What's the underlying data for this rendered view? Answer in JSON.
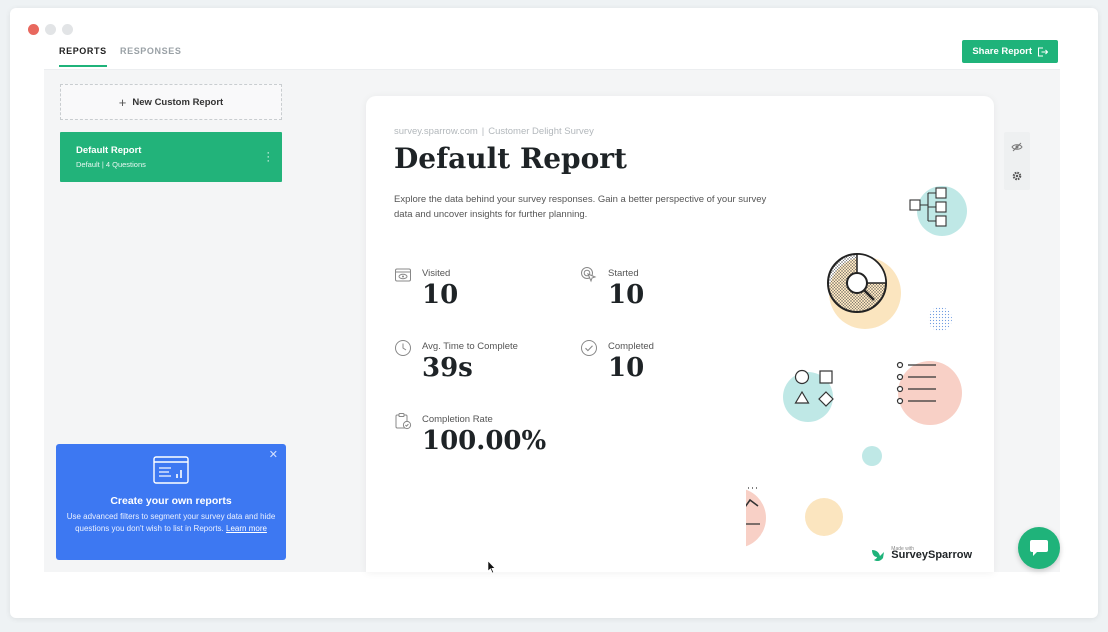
{
  "tabs": [
    {
      "label": "REPORTS",
      "active": true
    },
    {
      "label": "RESPONSES",
      "active": false
    }
  ],
  "share_button": {
    "label": "Share Report",
    "icon": "share-exit-icon"
  },
  "sidebar": {
    "new_report_label": "New Custom Report",
    "reports": [
      {
        "title": "Default Report",
        "subtitle": "Default | 4 Questions"
      }
    ],
    "promo": {
      "title": "Create your own reports",
      "text": "Use advanced filters to segment your survey data and hide questions you don't wish to list in Reports.",
      "link": "Learn more"
    }
  },
  "report": {
    "workspace": "survey.sparrow.com",
    "survey": "Customer Delight Survey",
    "title": "Default Report",
    "description": "Explore the data behind your survey responses. Gain a better perspective of your survey data and uncover insights for further planning.",
    "stats": [
      {
        "label": "Visited",
        "value": "10",
        "icon": "eye-screen-icon"
      },
      {
        "label": "Started",
        "value": "10",
        "icon": "pointer-click-icon"
      },
      {
        "label": "Avg. Time to Complete",
        "value": "39s",
        "icon": "clock-icon"
      },
      {
        "label": "Completed",
        "value": "10",
        "icon": "check-circle-icon"
      },
      {
        "label": "Completion Rate",
        "value": "100.00%",
        "icon": "clipboard-icon"
      }
    ],
    "brand": {
      "made_with": "Made with",
      "name": "SurveySparrow"
    }
  },
  "colors": {
    "accent": "#1fb37a",
    "promo": "#3d78f2",
    "circle_teal": "#bfe8e6",
    "circle_yellow": "#fbe5bf",
    "circle_pink": "#f8d0c6",
    "circle_blue": "#a9c3f0"
  }
}
